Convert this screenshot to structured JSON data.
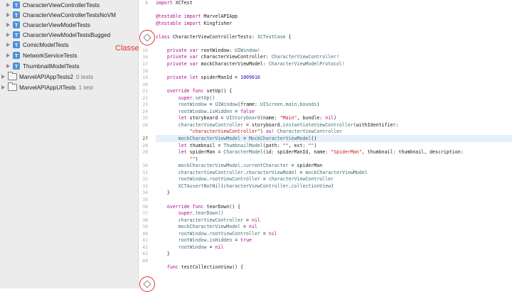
{
  "navigator": {
    "items": [
      {
        "kind": "test",
        "label": "CharacterViewControllerTests"
      },
      {
        "kind": "test",
        "label": "CharacterViewControllerTestsNoVM"
      },
      {
        "kind": "test",
        "label": "CharacterViewModelTests"
      },
      {
        "kind": "test",
        "label": "CharacterViewModelTestsBugged"
      },
      {
        "kind": "test",
        "label": "ComicModelTests"
      },
      {
        "kind": "test",
        "label": "NetworkServiceTests"
      },
      {
        "kind": "test",
        "label": "ThumbnailModelTests"
      },
      {
        "kind": "folder",
        "label": "MarvelAPIAppTests2",
        "count": "0 tests"
      },
      {
        "kind": "folder",
        "label": "MarvelAPIAppUITests",
        "count": "1 test"
      }
    ]
  },
  "annotation": {
    "label": "Classe",
    "color": "#e0302e"
  },
  "colors": {
    "keyword": "#aa0d91",
    "type": "#3f6e74",
    "string": "#c41a16",
    "number": "#1c00cf",
    "current_line": "#e6f0fb"
  },
  "editor": {
    "current_line": "27",
    "lines": [
      {
        "n": "8",
        "tokens": [
          {
            "t": "import",
            "c": "kw"
          },
          {
            "t": " XCTest",
            "c": "pl"
          }
        ]
      },
      {
        "n": "",
        "tokens": []
      },
      {
        "n": "",
        "tokens": [
          {
            "t": "@testable",
            "c": "kw"
          },
          {
            "t": " import",
            "c": "kw"
          },
          {
            "t": " MarvelAPIApp",
            "c": "pl"
          }
        ]
      },
      {
        "n": "",
        "tokens": [
          {
            "t": "@testable",
            "c": "kw"
          },
          {
            "t": " import",
            "c": "kw"
          },
          {
            "t": " Kingfisher",
            "c": "pl"
          }
        ]
      },
      {
        "n": "",
        "tokens": []
      },
      {
        "n": "",
        "tokens": [
          {
            "t": "class",
            "c": "kw"
          },
          {
            "t": " CharacterViewControllerTests: ",
            "c": "pl"
          },
          {
            "t": "XCTestCase",
            "c": "ty"
          },
          {
            "t": " {",
            "c": "pl"
          }
        ]
      },
      {
        "n": "",
        "tokens": []
      },
      {
        "n": "15",
        "tokens": [
          {
            "t": "    private",
            "c": "kw"
          },
          {
            "t": " var",
            "c": "kw"
          },
          {
            "t": " rootWindow: ",
            "c": "pl"
          },
          {
            "t": "UIWindow!",
            "c": "ty"
          }
        ]
      },
      {
        "n": "16",
        "tokens": [
          {
            "t": "    private",
            "c": "kw"
          },
          {
            "t": " var",
            "c": "kw"
          },
          {
            "t": " characterViewController: ",
            "c": "pl"
          },
          {
            "t": "CharacterViewController!",
            "c": "ty"
          }
        ]
      },
      {
        "n": "17",
        "tokens": [
          {
            "t": "    private",
            "c": "kw"
          },
          {
            "t": " var",
            "c": "kw"
          },
          {
            "t": " mockCharacterViewModel: ",
            "c": "pl"
          },
          {
            "t": "CharacterViewModelProtocol!",
            "c": "ty"
          }
        ]
      },
      {
        "n": "18",
        "tokens": []
      },
      {
        "n": "19",
        "tokens": [
          {
            "t": "    private",
            "c": "kw"
          },
          {
            "t": " let",
            "c": "kw"
          },
          {
            "t": " spiderManId = ",
            "c": "pl"
          },
          {
            "t": "1009610",
            "c": "num"
          }
        ]
      },
      {
        "n": "20",
        "tokens": []
      },
      {
        "n": "21",
        "tokens": [
          {
            "t": "    override",
            "c": "kw"
          },
          {
            "t": " func",
            "c": "kw"
          },
          {
            "t": " setUp() {",
            "c": "pl"
          }
        ]
      },
      {
        "n": "22",
        "tokens": [
          {
            "t": "        super",
            "c": "kw"
          },
          {
            "t": ".setUp()",
            "c": "ty"
          }
        ]
      },
      {
        "n": "23",
        "tokens": [
          {
            "t": "        rootWindow",
            "c": "ty"
          },
          {
            "t": " = ",
            "c": "pl"
          },
          {
            "t": "UIWindow",
            "c": "ty"
          },
          {
            "t": "(frame: ",
            "c": "pl"
          },
          {
            "t": "UIScreen",
            "c": "ty"
          },
          {
            "t": ".",
            "c": "pl"
          },
          {
            "t": "main",
            "c": "ty"
          },
          {
            "t": ".",
            "c": "pl"
          },
          {
            "t": "bounds",
            "c": "ty"
          },
          {
            "t": ")",
            "c": "pl"
          }
        ]
      },
      {
        "n": "24",
        "tokens": [
          {
            "t": "        rootWindow",
            "c": "ty"
          },
          {
            "t": ".",
            "c": "pl"
          },
          {
            "t": "isHidden",
            "c": "ty"
          },
          {
            "t": " = ",
            "c": "pl"
          },
          {
            "t": "false",
            "c": "kw"
          }
        ]
      },
      {
        "n": "25",
        "tokens": [
          {
            "t": "        let",
            "c": "kw"
          },
          {
            "t": " storyboard = ",
            "c": "pl"
          },
          {
            "t": "UIStoryboard",
            "c": "ty"
          },
          {
            "t": "(name: ",
            "c": "pl"
          },
          {
            "t": "\"Main\"",
            "c": "str"
          },
          {
            "t": ", bundle: ",
            "c": "pl"
          },
          {
            "t": "nil",
            "c": "kw"
          },
          {
            "t": ")",
            "c": "pl"
          }
        ]
      },
      {
        "n": "26",
        "tokens": [
          {
            "t": "        characterViewController",
            "c": "ty"
          },
          {
            "t": " = storyboard.",
            "c": "pl"
          },
          {
            "t": "instantiateViewController",
            "c": "ty"
          },
          {
            "t": "(withIdentifier:",
            "c": "pl"
          }
        ]
      },
      {
        "n": "",
        "tokens": [
          {
            "t": "            \"characterViewController\"",
            "c": "str"
          },
          {
            "t": ") ",
            "c": "pl"
          },
          {
            "t": "as!",
            "c": "kw"
          },
          {
            "t": " ",
            "c": "pl"
          },
          {
            "t": "CharacterViewController",
            "c": "ty"
          }
        ]
      },
      {
        "n": "27",
        "tokens": [
          {
            "t": "        mockCharacterViewModel",
            "c": "ty"
          },
          {
            "t": " = ",
            "c": "pl"
          },
          {
            "t": "MockCharacterViewModel",
            "c": "ty"
          },
          {
            "t": "()",
            "c": "pl"
          }
        ]
      },
      {
        "n": "28",
        "tokens": [
          {
            "t": "        let",
            "c": "kw"
          },
          {
            "t": " thumbnail = ",
            "c": "pl"
          },
          {
            "t": "ThumbnailModel",
            "c": "ty"
          },
          {
            "t": "(path: ",
            "c": "pl"
          },
          {
            "t": "\"\"",
            "c": "str"
          },
          {
            "t": ", ext: ",
            "c": "pl"
          },
          {
            "t": "\"\"",
            "c": "str"
          },
          {
            "t": ")",
            "c": "pl"
          }
        ]
      },
      {
        "n": "29",
        "tokens": [
          {
            "t": "        let",
            "c": "kw"
          },
          {
            "t": " spiderMan = ",
            "c": "pl"
          },
          {
            "t": "CharacterModel",
            "c": "ty"
          },
          {
            "t": "(id: spiderManId, name: ",
            "c": "pl"
          },
          {
            "t": "\"SpiderMan\"",
            "c": "str"
          },
          {
            "t": ", thumbnail: thumbnail, description:",
            "c": "pl"
          }
        ]
      },
      {
        "n": "",
        "tokens": [
          {
            "t": "            \"\"",
            "c": "str"
          },
          {
            "t": ")",
            "c": "pl"
          }
        ]
      },
      {
        "n": "30",
        "tokens": [
          {
            "t": "        mockCharacterViewModel",
            "c": "ty"
          },
          {
            "t": ".",
            "c": "pl"
          },
          {
            "t": "currentCharacter",
            "c": "ty"
          },
          {
            "t": " = spiderMan",
            "c": "pl"
          }
        ]
      },
      {
        "n": "31",
        "tokens": [
          {
            "t": "        characterViewController",
            "c": "ty"
          },
          {
            "t": ".",
            "c": "pl"
          },
          {
            "t": "characterViewModel",
            "c": "ty"
          },
          {
            "t": " = ",
            "c": "pl"
          },
          {
            "t": "mockCharacterViewModel",
            "c": "ty"
          }
        ]
      },
      {
        "n": "32",
        "tokens": [
          {
            "t": "        rootWindow",
            "c": "ty"
          },
          {
            "t": ".",
            "c": "pl"
          },
          {
            "t": "rootViewController",
            "c": "ty"
          },
          {
            "t": " = ",
            "c": "pl"
          },
          {
            "t": "characterViewController",
            "c": "ty"
          }
        ]
      },
      {
        "n": "33",
        "tokens": [
          {
            "t": "        XCTAssertNotNil",
            "c": "ty"
          },
          {
            "t": "(",
            "c": "pl"
          },
          {
            "t": "characterViewController",
            "c": "ty"
          },
          {
            "t": ".",
            "c": "pl"
          },
          {
            "t": "collectionView",
            "c": "ty"
          },
          {
            "t": ")",
            "c": "pl"
          }
        ]
      },
      {
        "n": "34",
        "tokens": [
          {
            "t": "    }",
            "c": "pl"
          }
        ]
      },
      {
        "n": "35",
        "tokens": []
      },
      {
        "n": "36",
        "tokens": [
          {
            "t": "    override",
            "c": "kw"
          },
          {
            "t": " func",
            "c": "kw"
          },
          {
            "t": " tearDown() {",
            "c": "pl"
          }
        ]
      },
      {
        "n": "37",
        "tokens": [
          {
            "t": "        super",
            "c": "kw"
          },
          {
            "t": ".tearDown()",
            "c": "ty"
          }
        ]
      },
      {
        "n": "38",
        "tokens": [
          {
            "t": "        characterViewController",
            "c": "ty"
          },
          {
            "t": " = ",
            "c": "pl"
          },
          {
            "t": "nil",
            "c": "kw"
          }
        ]
      },
      {
        "n": "39",
        "tokens": [
          {
            "t": "        mockCharacterViewModel",
            "c": "ty"
          },
          {
            "t": " = ",
            "c": "pl"
          },
          {
            "t": "nil",
            "c": "kw"
          }
        ]
      },
      {
        "n": "40",
        "tokens": [
          {
            "t": "        rootWindow",
            "c": "ty"
          },
          {
            "t": ".",
            "c": "pl"
          },
          {
            "t": "rootViewController",
            "c": "ty"
          },
          {
            "t": " = ",
            "c": "pl"
          },
          {
            "t": "nil",
            "c": "kw"
          }
        ]
      },
      {
        "n": "41",
        "tokens": [
          {
            "t": "        rootWindow",
            "c": "ty"
          },
          {
            "t": ".",
            "c": "pl"
          },
          {
            "t": "isHidden",
            "c": "ty"
          },
          {
            "t": " = ",
            "c": "pl"
          },
          {
            "t": "true",
            "c": "kw"
          }
        ]
      },
      {
        "n": "42",
        "tokens": [
          {
            "t": "        rootWindow",
            "c": "ty"
          },
          {
            "t": " = ",
            "c": "pl"
          },
          {
            "t": "nil",
            "c": "kw"
          }
        ]
      },
      {
        "n": "43",
        "tokens": [
          {
            "t": "    }",
            "c": "pl"
          }
        ]
      },
      {
        "n": "44",
        "tokens": []
      },
      {
        "n": "",
        "tokens": [
          {
            "t": "    func",
            "c": "kw"
          },
          {
            "t": " testCollectionView() {",
            "c": "pl"
          }
        ]
      }
    ]
  }
}
